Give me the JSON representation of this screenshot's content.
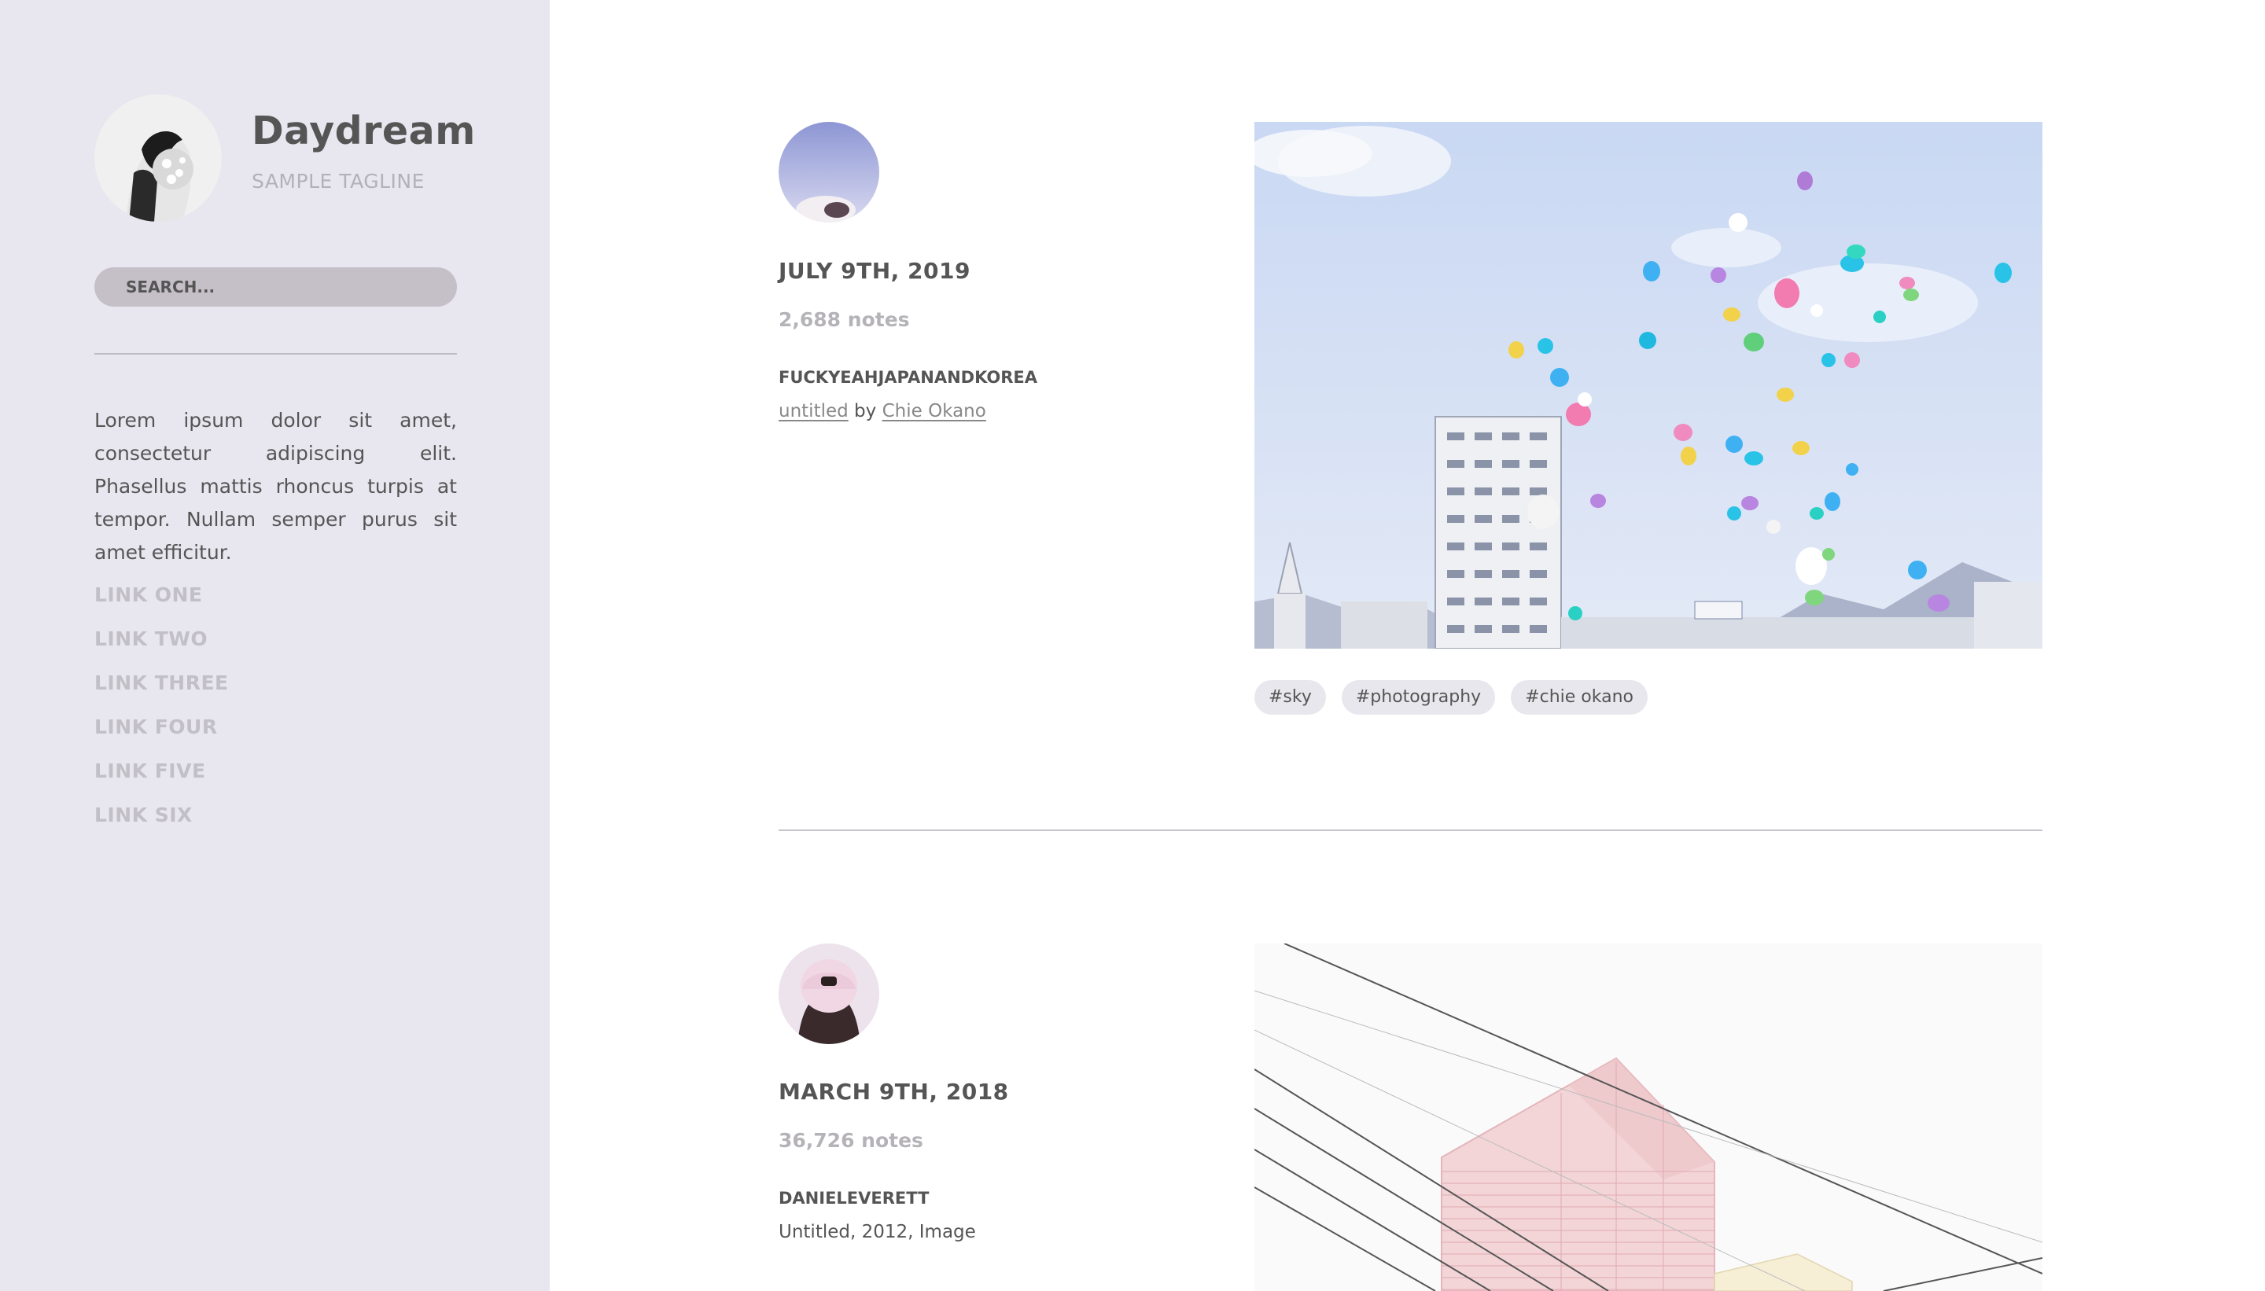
{
  "sidebar": {
    "title": "Daydream",
    "tagline": "SAMPLE TAGLINE",
    "search_placeholder": "SEARCH...",
    "description": "Lorem ipsum dolor sit amet, consectetur adipiscing elit. Phasellus mattis rhoncus turpis at tempor. Nullam semper purus sit amet efficitur.",
    "links": [
      "LINK ONE",
      "LINK TWO",
      "LINK THREE",
      "LINK FOUR",
      "LINK FIVE",
      "LINK SIX"
    ]
  },
  "posts": [
    {
      "date": "JULY 9TH, 2019",
      "notes": "2,688 notes",
      "user": "FUCKYEAHJAPANANDKOREA",
      "caption_title": "untitled",
      "caption_by": "by",
      "caption_author": "Chie Okano",
      "tags": [
        "#sky",
        "#photography",
        "#chie okano"
      ]
    },
    {
      "date": "MARCH 9TH, 2018",
      "notes": "36,726 notes",
      "user": "DANIELEVERETT",
      "caption": "Untitled, 2012, Image"
    }
  ],
  "colors": {
    "sidebar_bg": "#e8e6ef",
    "text": "#555555",
    "muted": "#b5b3b8",
    "search_bg": "#c5c0c7",
    "tag_bg": "#e9e7ee"
  }
}
